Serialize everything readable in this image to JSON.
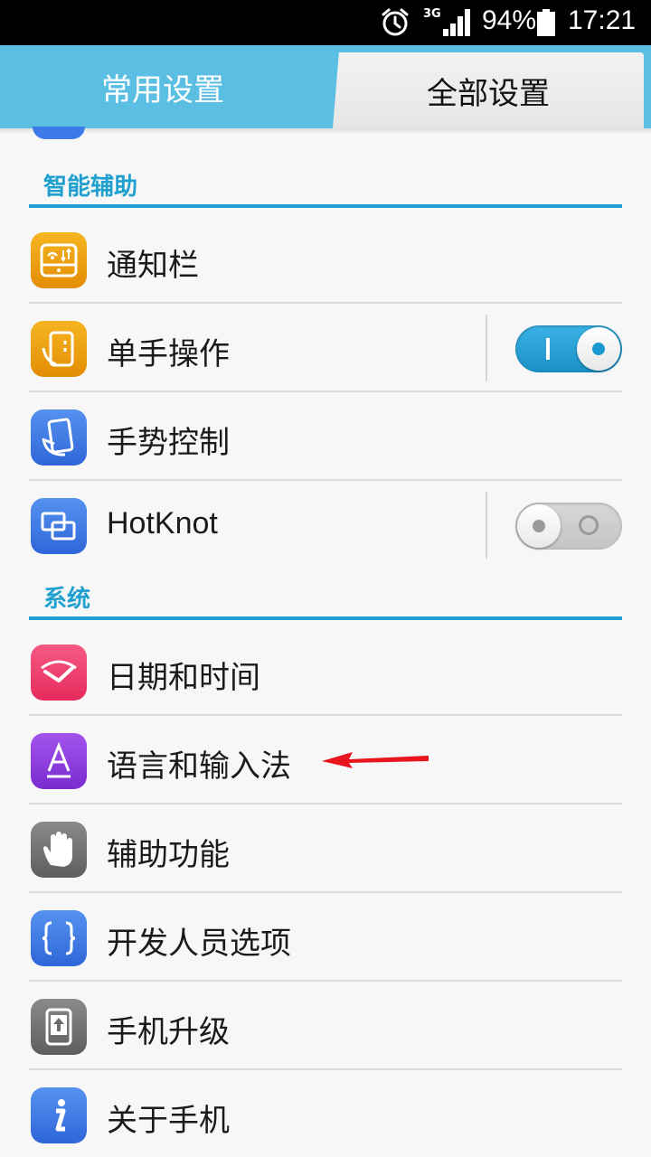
{
  "status_bar": {
    "network": "3G",
    "battery_percent": "94%",
    "time": "17:21",
    "icons": [
      "alarm-icon",
      "signal-icon",
      "battery-icon"
    ]
  },
  "tabs": [
    {
      "label": "常用设置",
      "active": false
    },
    {
      "label": "全部设置",
      "active": true
    }
  ],
  "sections": {
    "smart_assist": {
      "title": "智能辅助",
      "items": [
        {
          "label": "通知栏",
          "icon": "notification-bar-icon",
          "color": "#f0a30a"
        },
        {
          "label": "单手操作",
          "icon": "one-hand-icon",
          "color": "#f0a30a",
          "toggle": true
        },
        {
          "label": "手势控制",
          "icon": "gesture-icon",
          "color": "#3d7ae8"
        },
        {
          "label": "HotKnot",
          "icon": "hotknot-icon",
          "color": "#3d7ae8",
          "toggle": false
        }
      ]
    },
    "system": {
      "title": "系统",
      "items": [
        {
          "label": "日期和时间",
          "icon": "clock-icon",
          "color": "#ee3a6c"
        },
        {
          "label": "语言和输入法",
          "icon": "language-icon",
          "color": "#8a3cdc"
        },
        {
          "label": "辅助功能",
          "icon": "hand-icon",
          "color": "#6a6a6a"
        },
        {
          "label": "开发人员选项",
          "icon": "braces-icon",
          "color": "#3d7ae8"
        },
        {
          "label": "手机升级",
          "icon": "upgrade-icon",
          "color": "#6a6a6a"
        },
        {
          "label": "关于手机",
          "icon": "info-icon",
          "color": "#3d7ae8"
        }
      ]
    }
  },
  "annotation": {
    "type": "red-arrow",
    "points_to": "语言和输入法"
  }
}
